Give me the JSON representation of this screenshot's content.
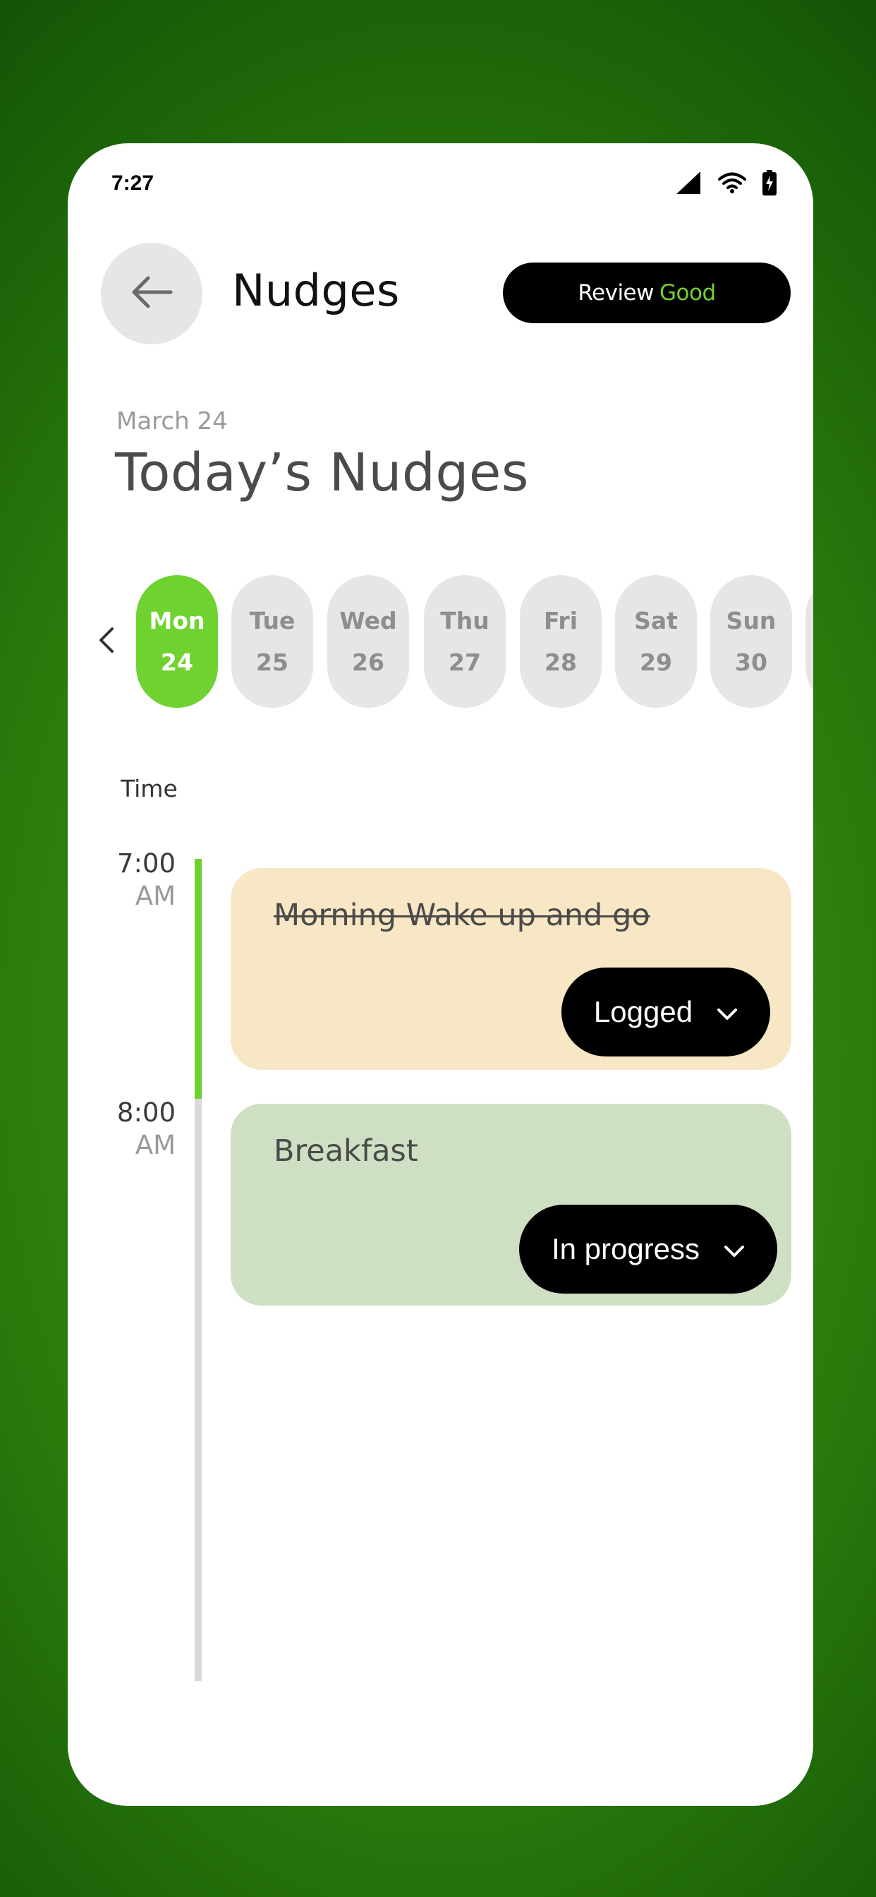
{
  "status_bar": {
    "time": "7:27",
    "icons": [
      "signal-icon",
      "wifi-icon",
      "battery-charging-icon"
    ]
  },
  "header": {
    "back_icon": "arrow-left-icon",
    "title": "Nudges",
    "review_label": "Review",
    "review_value": "Good",
    "review_value_color": "#75d12f"
  },
  "date_label": "March 24",
  "page_title": "Today’s Nudges",
  "week": {
    "prev_icon": "chevron-left-icon",
    "selected_color": "#6fd231",
    "days": [
      {
        "name": "Mon",
        "num": "24",
        "selected": true
      },
      {
        "name": "Tue",
        "num": "25",
        "selected": false
      },
      {
        "name": "Wed",
        "num": "26",
        "selected": false
      },
      {
        "name": "Thu",
        "num": "27",
        "selected": false
      },
      {
        "name": "Fri",
        "num": "28",
        "selected": false
      },
      {
        "name": "Sat",
        "num": "29",
        "selected": false
      },
      {
        "name": "Sun",
        "num": "30",
        "selected": false
      }
    ]
  },
  "timeline": {
    "header": "Time",
    "slots": [
      {
        "time": "7:00",
        "ampm": "AM"
      },
      {
        "time": "8:00",
        "ampm": "AM"
      }
    ]
  },
  "nudges": [
    {
      "title": "Morning Wake up and go",
      "status": "Logged",
      "completed": true,
      "color": "#f8e7c4"
    },
    {
      "title": "Breakfast",
      "status": "In progress",
      "completed": false,
      "color": "#cfdfc4"
    }
  ]
}
